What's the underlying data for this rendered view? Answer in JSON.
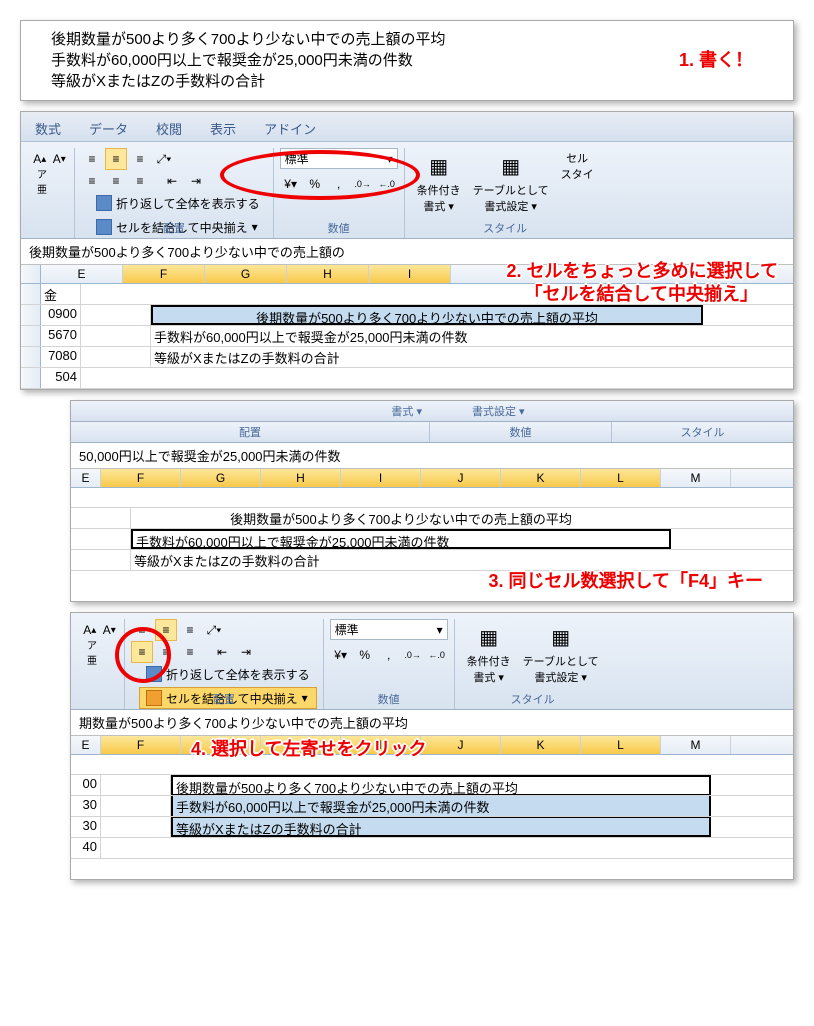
{
  "annotations": {
    "step1": "1. 書く！",
    "step2a": "2. セルをちょっと多めに選択して",
    "step2b": "「セルを結合して中央揃え」",
    "step3": "3. 同じセル数選択して「F4」キー",
    "step4": "4. 選択して左寄せをクリック"
  },
  "text_lines": {
    "line1": "後期数量が500より多く700より少ない中での売上額の平均",
    "line2": "手数料が60,000円以上で報奨金が25,000円未満の件数",
    "line3": "等級がXまたはZの手数料の合計"
  },
  "ribbon": {
    "tabs": [
      "数式",
      "データ",
      "校閲",
      "表示",
      "アドイン"
    ],
    "wrap_text": "折り返して全体を表示する",
    "merge_center": "セルを結合して中央揃え",
    "group_align": "配置",
    "group_number": "数値",
    "group_style": "スタイル",
    "number_format": "標準",
    "cond_format": "条件付き",
    "cond_format2": "書式 ▾",
    "table_format": "テーブルとして",
    "table_format2": "書式設定 ▾",
    "cell_style": "セル",
    "cell_style2": "スタイ",
    "style_short": "書式設定 ▾",
    "book_style": "書式 ▾"
  },
  "panel2": {
    "formula": "後期数量が500より多く700より少ない中での売上額の",
    "cols": [
      "E",
      "F",
      "G",
      "H",
      "I"
    ],
    "row_a": "金",
    "vals": [
      "0900",
      "5670",
      "7080",
      "504"
    ]
  },
  "panel3": {
    "formula": "50,000円以上で報奨金が25,000円未満の件数",
    "cols": [
      "E",
      "F",
      "G",
      "H",
      "I",
      "J",
      "K",
      "L",
      "M"
    ]
  },
  "panel4": {
    "formula": "期数量が500より多く700より少ない中での売上額の平均",
    "cols": [
      "E",
      "F",
      "G",
      "H",
      "I",
      "J",
      "K",
      "L",
      "M"
    ],
    "vals": [
      "00",
      "30",
      "30",
      "40"
    ]
  }
}
